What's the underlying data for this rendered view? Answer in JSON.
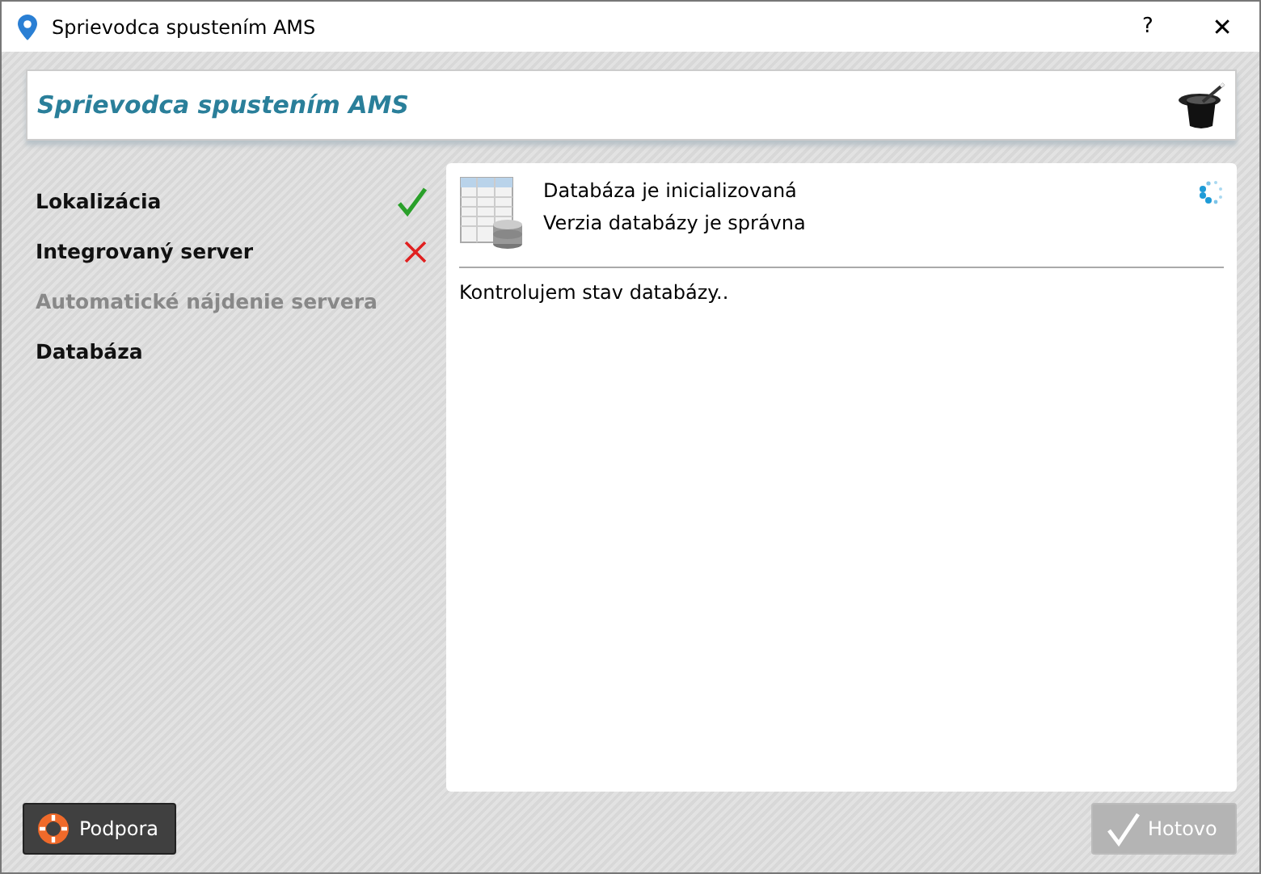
{
  "window": {
    "title": "Sprievodca spustením AMS",
    "buttons": [
      "?",
      "✕"
    ]
  },
  "header": {
    "title": "Sprievodca spustením AMS"
  },
  "steps": [
    {
      "label": "Lokalizácia",
      "disabled": false,
      "completed": true,
      "failed": false
    },
    {
      "label": "Integrovaný server",
      "disabled": false,
      "completed": false,
      "failed": true
    },
    {
      "label": "Automatické nájdenie servera",
      "disabled": true,
      "completed": false,
      "failed": false
    },
    {
      "label": "Databáza",
      "disabled": false,
      "completed": false,
      "failed": false
    }
  ],
  "content": {
    "messages": [
      "Databáza je inicializovaná",
      "Verzia databázy je správna"
    ],
    "log": "Kontrolujem stav databázy.."
  },
  "footer": {
    "support": {
      "label": "Podpora"
    },
    "done": {
      "label": "Hotovo",
      "disabled": true
    }
  }
}
